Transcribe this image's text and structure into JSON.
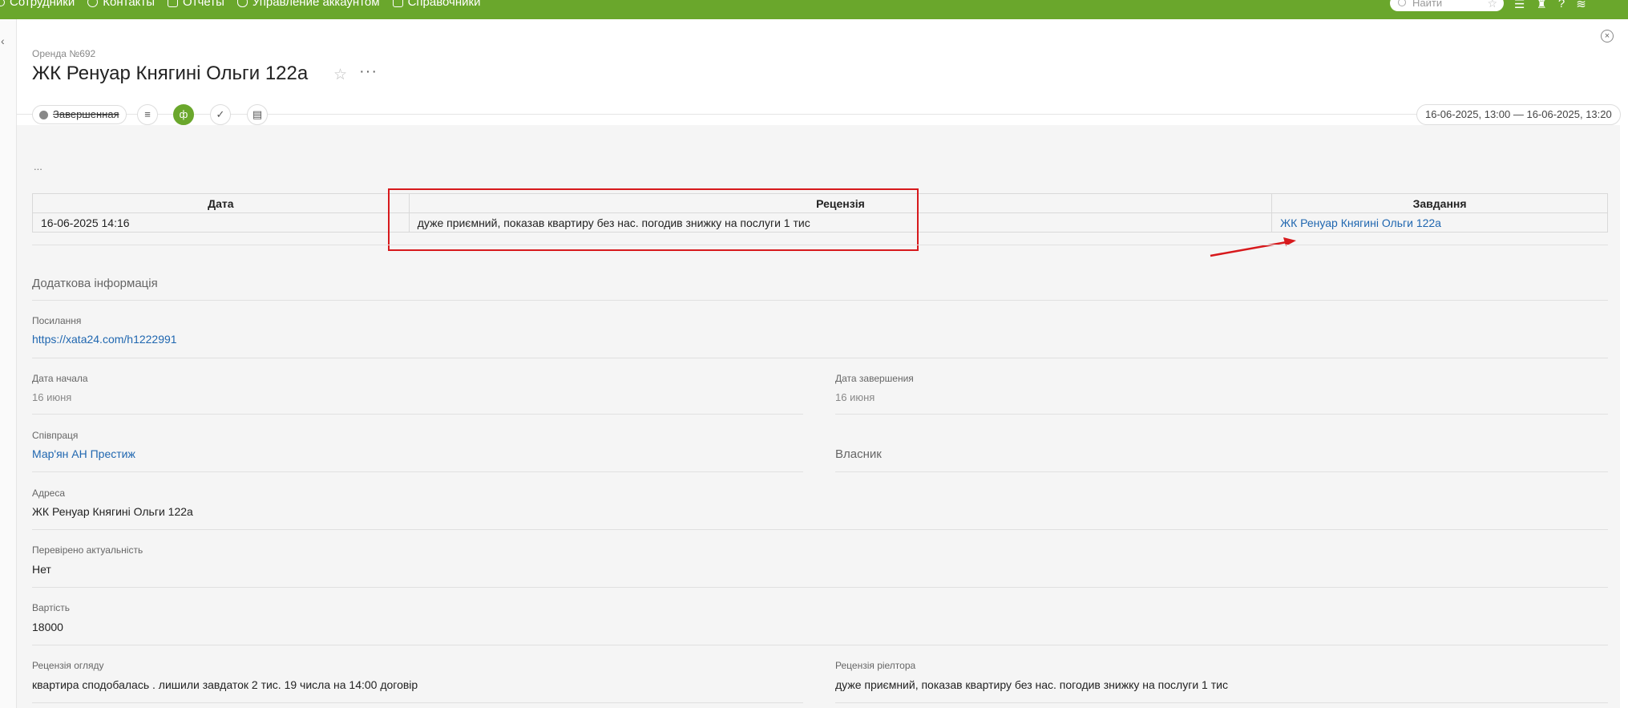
{
  "topbar": {
    "nav": [
      {
        "label": "Сотрудники",
        "icon": "people-icon"
      },
      {
        "label": "Контакты",
        "icon": "contacts-icon"
      },
      {
        "label": "Отчеты",
        "icon": "reports-icon"
      },
      {
        "label": "Управление аккаунтом",
        "icon": "account-icon"
      },
      {
        "label": "Справочники",
        "icon": "directory-icon"
      }
    ],
    "search_placeholder": "Найти",
    "icons": [
      "menu-icon",
      "user-icon",
      "help-icon",
      "layers-icon"
    ]
  },
  "header": {
    "subtitle": "Оренда №692",
    "title": "ЖК Ренуар Княгині Ольги 122а"
  },
  "toolbar": {
    "status_label": "Завершенная",
    "buttons": [
      "list-icon",
      "finance-icon",
      "check-icon",
      "comment-icon"
    ],
    "date_range": "16-06-2025, 13:00 — 16-06-2025, 13:20"
  },
  "main": {
    "dash": "...",
    "review_table": {
      "headers": [
        "Дата",
        "Рецензія",
        "Завдання"
      ],
      "rows": [
        {
          "date": "16-06-2025 14:16",
          "review": "дуже приємний, показав квартиру без нас. погодив знижку на послуги 1 тис",
          "task": "ЖК Ренуар Княгині Ольги 122а"
        }
      ]
    },
    "extra_section_title": "Додаткова інформація",
    "fields": {
      "link_label": "Посилання",
      "link_value": "https://xata24.com/h1222991",
      "start_label": "Дата начала",
      "start_value": "16 июня",
      "end_label": "Дата завершения",
      "end_value": "16 июня",
      "coop_label": "Співпраця",
      "coop_value": "Мар'ян АН Престиж",
      "owner_label": "Власник",
      "address_label": "Адреса",
      "address_value": "ЖК Ренуар Княгині Ольги 122а",
      "checked_label": "Перевірено актуальність",
      "checked_value": "Нет",
      "price_label": "Вартість",
      "price_value": "18000",
      "review_view_label": "Рецензія огляду",
      "review_view_value": "квартира сподобалась . лишили завдаток 2 тис. 19 числа на 14:00 договір",
      "review_realtor_label": "Рецензія ріелтора",
      "review_realtor_value": "дуже приємний, показав квартиру без нас. погодив знижку на послуги 1 тис"
    }
  },
  "colors": {
    "topbar": "#6aa72c",
    "link": "#2067b0",
    "highlight": "#d7191c"
  }
}
